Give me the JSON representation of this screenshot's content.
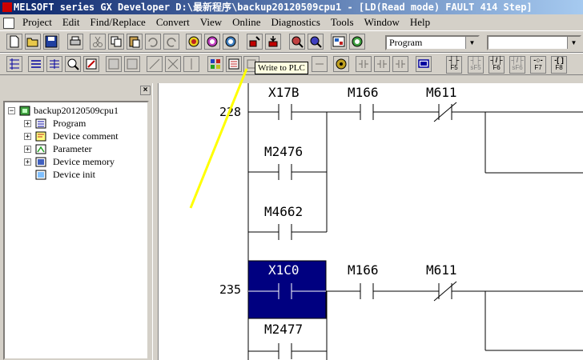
{
  "window": {
    "title": "MELSOFT series GX Developer D:\\最新程序\\backup20120509cpu1 - [LD(Read mode)     FAULT    414 Step]"
  },
  "menu": [
    "Project",
    "Edit",
    "Find/Replace",
    "Convert",
    "View",
    "Online",
    "Diagnostics",
    "Tools",
    "Window",
    "Help"
  ],
  "toolbar": {
    "combo_program": "Program",
    "combo_second": "",
    "tooltip": "Write to PLC",
    "fkeys": [
      {
        "sym": "┤├",
        "label": "F5"
      },
      {
        "sym": "┤├",
        "label": "sF5"
      },
      {
        "sym": "┤/├",
        "label": "F6"
      },
      {
        "sym": "┤/├",
        "label": "sF6"
      },
      {
        "sym": "-○-",
        "label": "F7"
      },
      {
        "sym": "-[ ]",
        "label": "F8"
      }
    ]
  },
  "tree": {
    "root": "backup20120509cpu1",
    "items": [
      "Program",
      "Device comment",
      "Parameter",
      "Device memory",
      "Device init"
    ]
  },
  "ladder": {
    "rungs": [
      {
        "step": "228",
        "contacts": [
          "X17B",
          "M166",
          "M611"
        ],
        "branches": [
          "M2476",
          "M4662"
        ]
      },
      {
        "step": "235",
        "contacts": [
          "X1C0",
          "M166",
          "M611"
        ],
        "branches": [
          "M2477"
        ]
      }
    ]
  },
  "colors": {
    "title_start": "#0a246a",
    "title_end": "#a6caf0",
    "selection": "#000080",
    "annotation": "#ffff00"
  }
}
